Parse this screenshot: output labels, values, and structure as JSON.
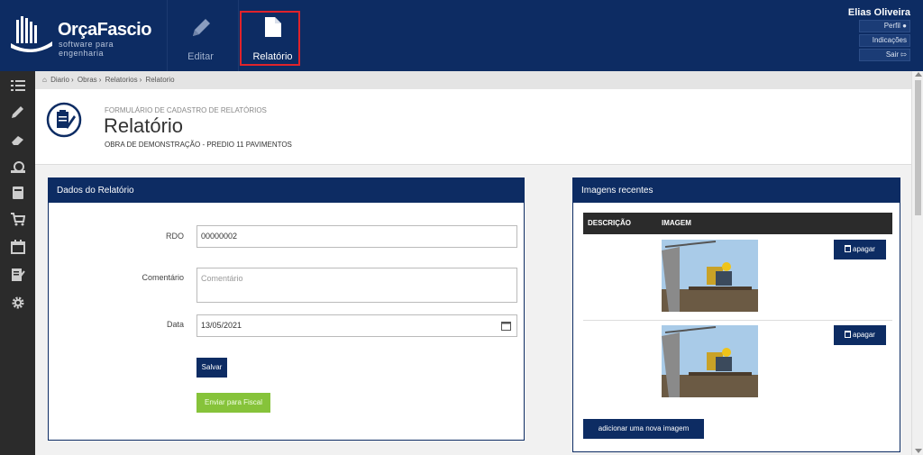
{
  "brand": {
    "name": "OrçaFascio",
    "tagline": "software para engenharia"
  },
  "topnav": {
    "editar_label": "Editar",
    "relatorio_label": "Relatório"
  },
  "user": {
    "name": "Elias Oliveira",
    "perfil": "Perfil",
    "indicacoes": "Indicações",
    "sair": "Sair"
  },
  "sidebar": {
    "icons": [
      "list-icon",
      "pencil-icon",
      "eraser-icon",
      "money-icon",
      "book-icon",
      "cart-icon",
      "calendar-icon",
      "checklist-icon",
      "gear-icon"
    ]
  },
  "breadcrumb": [
    "Diario",
    "Obras",
    "Relatorios",
    "Relatorio"
  ],
  "header": {
    "subtitle": "FORMULÁRIO DE CADASTRO DE RELATÓRIOS",
    "title": "Relatório",
    "obra": "OBRA DE DEMONSTRAÇÃO - PREDIO 11 PAVIMENTOS"
  },
  "form": {
    "panel_title": "Dados do Relatório",
    "rdo_label": "RDO",
    "rdo_value": "00000002",
    "comentario_label": "Comentário",
    "comentario_placeholder": "Comentário",
    "data_label": "Data",
    "data_value": "13/05/2021",
    "salvar": "Salvar",
    "enviar_fiscal": "Enviar para Fiscal"
  },
  "images": {
    "panel_title": "Imagens recentes",
    "col_descricao": "DESCRIÇÃO",
    "col_imagem": "IMAGEM",
    "apagar": "apagar",
    "add_button": "adicionar uma nova imagem"
  },
  "colors": {
    "navy": "#0d2c63",
    "highlight_red": "#e0232b",
    "green": "#86c33a"
  }
}
